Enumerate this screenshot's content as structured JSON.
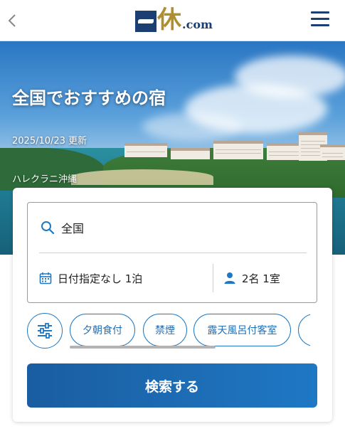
{
  "header": {
    "logo_kanji": "休",
    "logo_suffix": ".com"
  },
  "hero": {
    "title": "全国でおすすめの宿",
    "date": "2025/10/23 更新",
    "caption": "ハレクラニ沖縄"
  },
  "search": {
    "destination": "全国",
    "dates": "日付指定なし 1泊",
    "guests": "2名 1室",
    "chips": [
      "夕朝食付",
      "禁煙",
      "露天風呂付客室"
    ],
    "button_label": "検索する"
  },
  "colors": {
    "brand_navy": "#1b3f73",
    "brand_gold": "#b08d2e",
    "accent_blue": "#1f78c4"
  }
}
